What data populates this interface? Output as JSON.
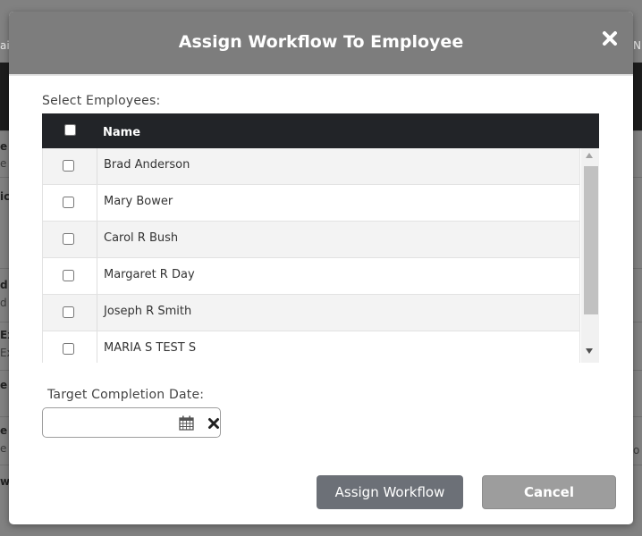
{
  "modal": {
    "title": "Assign Workflow To Employee",
    "close_icon": "close-icon"
  },
  "employees": {
    "section_label": "Select Employees:",
    "column_header": "Name",
    "select_all_checked": false,
    "rows": [
      {
        "name": "Brad Anderson",
        "checked": false
      },
      {
        "name": "Mary Bower",
        "checked": false
      },
      {
        "name": "Carol R Bush",
        "checked": false
      },
      {
        "name": "Margaret R Day",
        "checked": false
      },
      {
        "name": "Joseph R Smith",
        "checked": false
      },
      {
        "name": "MARIA S TEST S",
        "checked": false
      }
    ]
  },
  "target_date": {
    "label": "Target Completion Date:",
    "value": "",
    "calendar_icon": "calendar-icon",
    "clear_icon": "clear-date-icon"
  },
  "actions": {
    "assign_label": "Assign Workflow",
    "cancel_label": "Cancel"
  },
  "colors": {
    "header_bg": "#7d7d7d",
    "table_header_bg": "#222428",
    "assign_button": "#6c7077",
    "cancel_button": "#9d9d9d"
  }
}
